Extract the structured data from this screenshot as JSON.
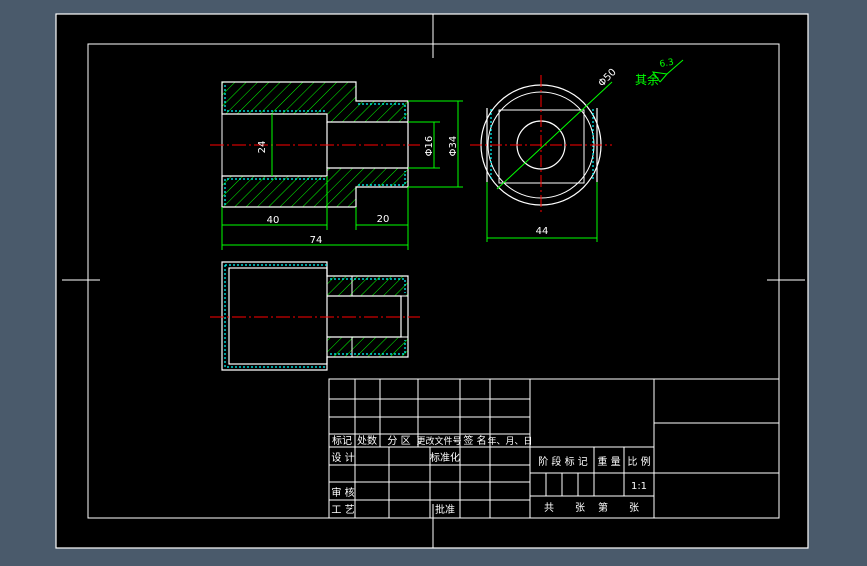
{
  "colors": {
    "canvas_bg": "#4a5a6b",
    "sheet_bg": "#000000",
    "sheet_border": "#ffffff",
    "outline": "#ffffff",
    "geometry": "#ffffff",
    "hatch": "#00ff00",
    "hidden_edges": "#00ffff",
    "centerline": "#ff0000",
    "dimension": "#00ff00",
    "title_text": "#ffffff",
    "roughness": "#00ff00"
  },
  "dimensions": {
    "inner_dia": "24",
    "hole_dia": "Φ16",
    "outer_dia": "Φ34",
    "length_40": "40",
    "length_20": "20",
    "length_74": "74",
    "circle_dia": "Φ50",
    "width_44": "44"
  },
  "roughness": {
    "label": "其余",
    "value": "6.3"
  },
  "title_block": {
    "revision_labels": [
      "标记",
      "处数",
      "分 区",
      "更改文件号",
      "签 名",
      "年、月、日"
    ],
    "design": "设 计",
    "standardize": "标准化",
    "review": "审 核",
    "process": "工 艺",
    "approve": "批准",
    "stage_mark": "阶 段 标 记",
    "weight": "重 量",
    "scale_label": "比 例",
    "scale_value": "1:1",
    "sheets_total_prefix": "共",
    "sheets_total_suffix": "张",
    "sheet_no_prefix": "第",
    "sheet_no_suffix": "张"
  }
}
